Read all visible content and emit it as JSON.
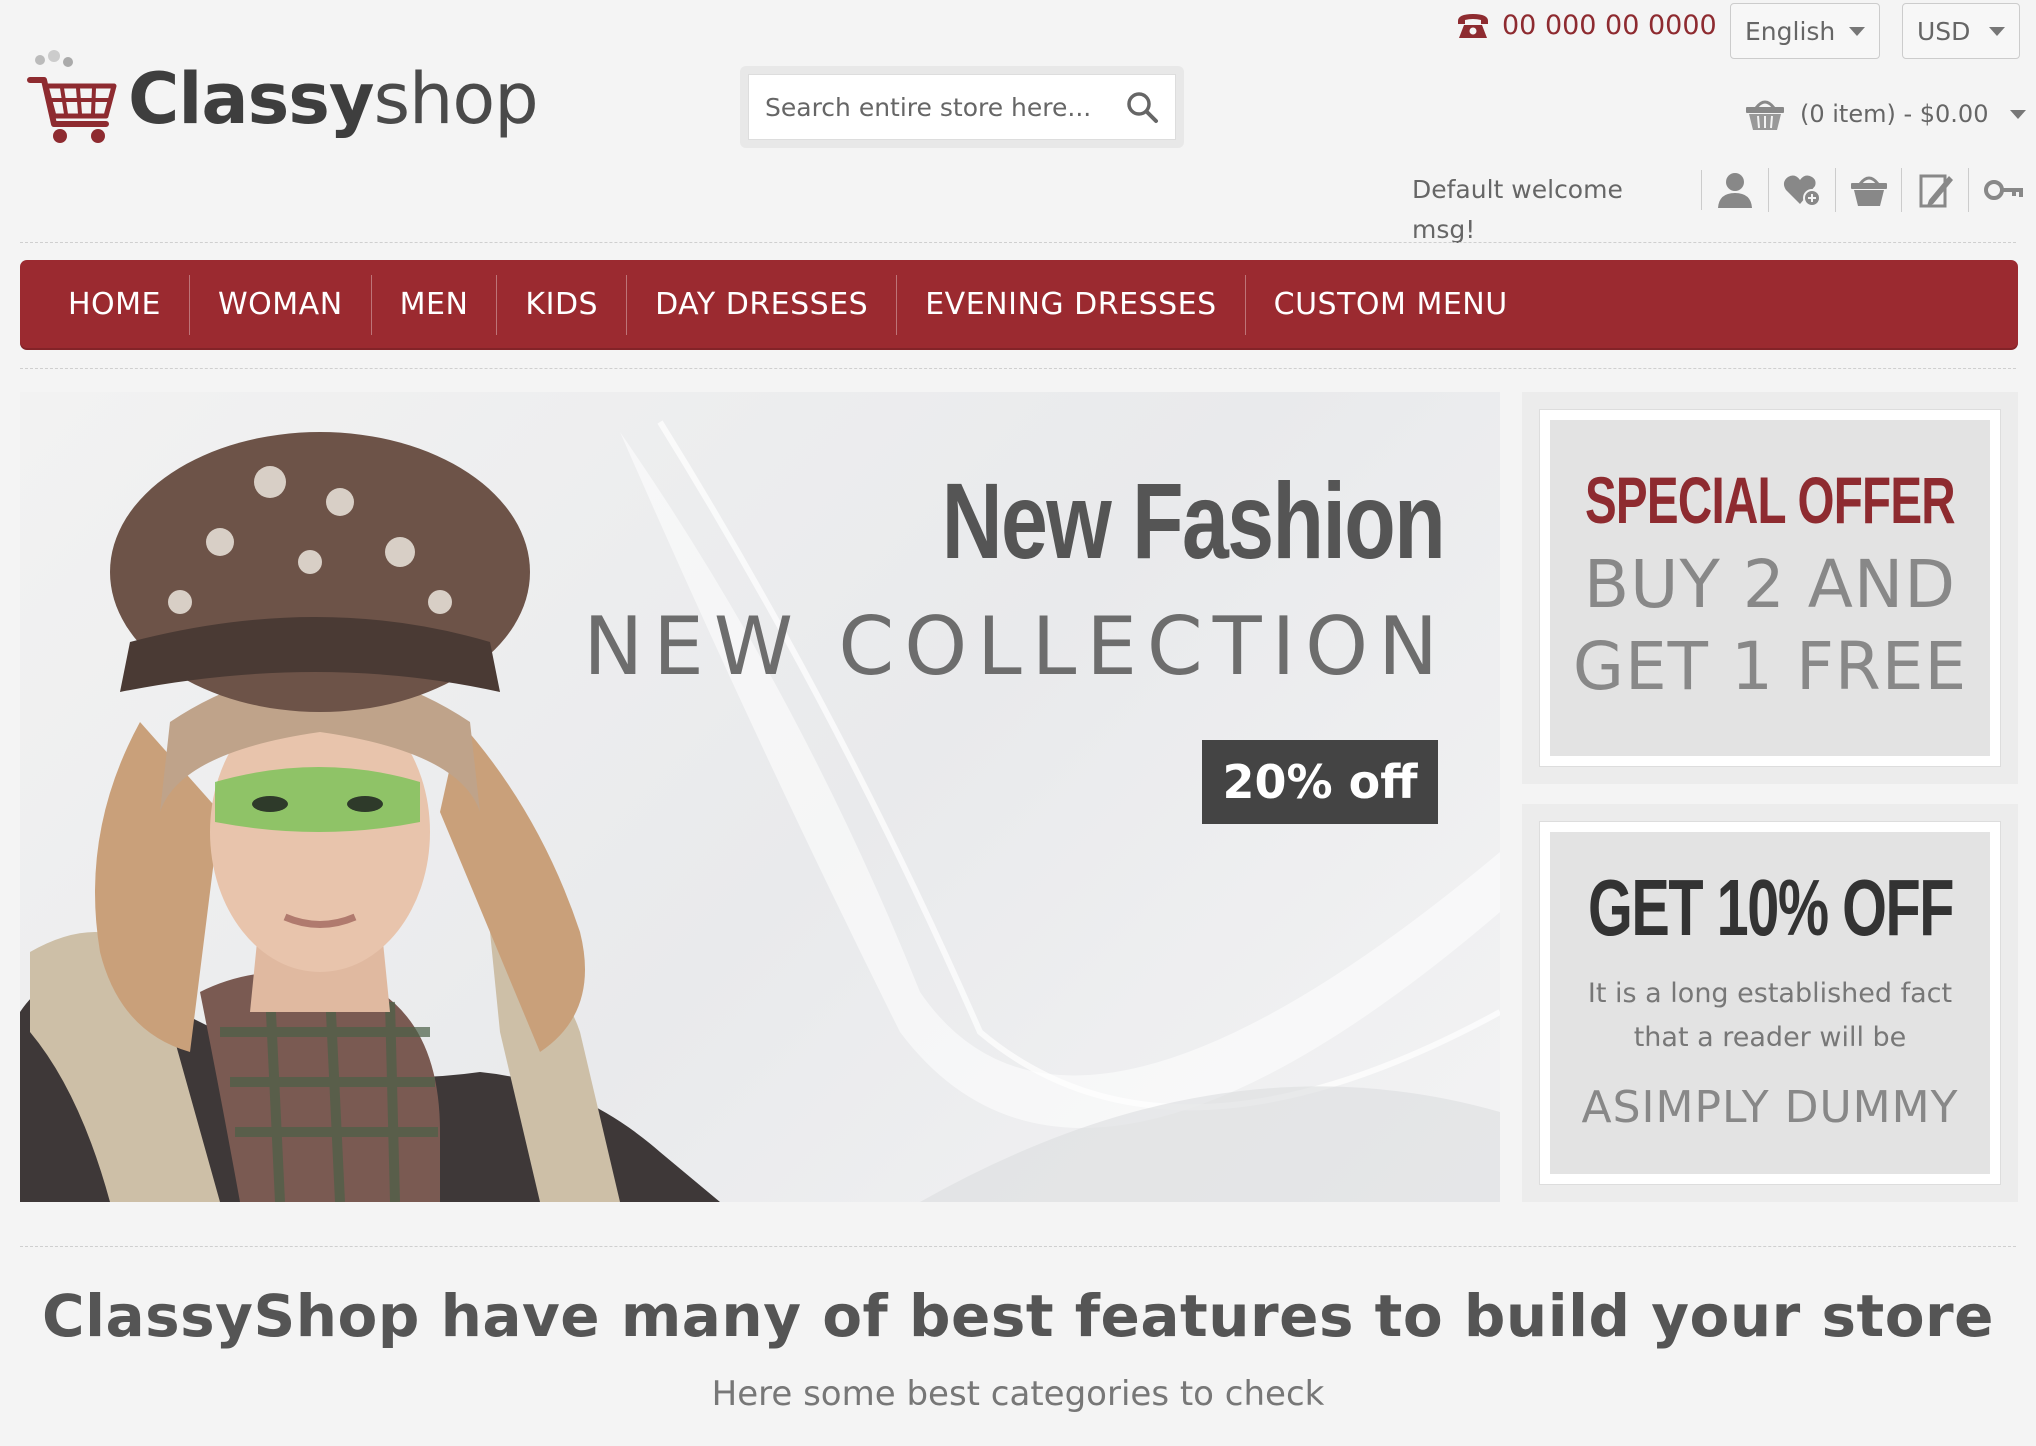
{
  "header": {
    "logo": {
      "bold": "Classy",
      "light": "shop"
    },
    "phone": "00 000 00 0000",
    "language": "English",
    "currency": "USD",
    "search": {
      "placeholder": "Search entire store here..."
    },
    "cart_summary": "(0 item) - $0.00",
    "welcome": "Default welcome msg!",
    "account_icons": [
      "user-icon",
      "wishlist-icon",
      "basket-icon",
      "edit-icon",
      "key-icon"
    ]
  },
  "nav": {
    "items": [
      "HOME",
      "WOMAN",
      "MEN",
      "KIDS",
      "DAY DRESSES",
      "EVENING DRESSES",
      "CUSTOM MENU"
    ]
  },
  "banner": {
    "title": "New Fashion",
    "subtitle": "NEW COLLECTION",
    "badge": "20% off"
  },
  "promo1": {
    "title": "SPECIAL OFFER",
    "line1": "BUY 2 AND",
    "line2": "GET 1 FREE"
  },
  "promo2": {
    "title": "GET 10% OFF",
    "text1": "It is a long established fact",
    "text2": "that a reader will be",
    "footer": "ASIMPLY DUMMY"
  },
  "features": {
    "title": "ClassyShop have many of best features to build your store",
    "subtitle": "Here some best categories to check"
  },
  "colors": {
    "brand_red": "#9b2a30",
    "background": "#f4f4f4",
    "dark_badge": "#444444"
  }
}
